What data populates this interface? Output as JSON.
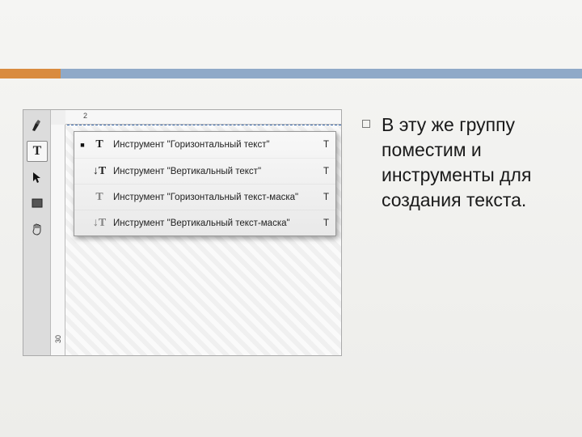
{
  "ruler": {
    "h_label": "2",
    "v_label": "30"
  },
  "toolbox": {
    "pen": "✒",
    "type": "T",
    "path": "↖",
    "rect": "■",
    "hand": "✋"
  },
  "flyout": {
    "mark": "■",
    "items": [
      {
        "icon": "T",
        "style": "plain",
        "label": "Инструмент \"Горизонтальный текст\"",
        "shortcut": "T"
      },
      {
        "icon": "↓T",
        "style": "plain",
        "label": "Инструмент \"Вертикальный текст\"",
        "shortcut": "T"
      },
      {
        "icon": "T",
        "style": "dotted",
        "label": "Инструмент \"Горизонтальный текст-маска\"",
        "shortcut": "T"
      },
      {
        "icon": "↓T",
        "style": "dotted",
        "label": "Инструмент \"Вертикальный текст-маска\"",
        "shortcut": "T"
      }
    ]
  },
  "slide": {
    "paragraph": "В эту же группу поместим и инструменты для создания текста."
  }
}
